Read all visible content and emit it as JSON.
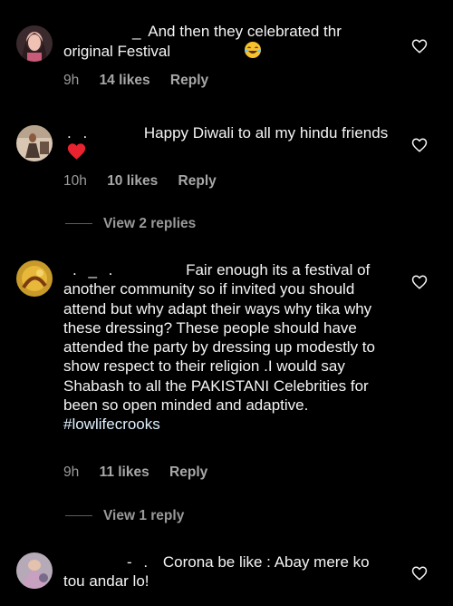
{
  "comments": [
    {
      "user": "_",
      "text": "And then they celebrated thr original Festival",
      "emoji": "laughing-tears-emoji",
      "time": "9h",
      "likes": "14 likes",
      "reply_label": "Reply"
    },
    {
      "user": ". .",
      "text": "Happy Diwali to all my hindu friends",
      "emoji": "red-heart-emoji",
      "time": "10h",
      "likes": "10 likes",
      "reply_label": "Reply",
      "view_replies": "View 2 replies"
    },
    {
      "user": ". _ .",
      "text": "Fair enough its a festival of another community so if invited you should attend but why adapt their ways why tika why these dressing? These people should have attended the party by dressing up modestly to show respect to their religion .I would say  Shabash to all the PAKISTANI Celebrities for been so open minded and adaptive.",
      "hashtag": "#lowlifecrooks",
      "time": "9h",
      "likes": "11 likes",
      "reply_label": "Reply",
      "view_replies": "View 1 reply"
    },
    {
      "user": "- .",
      "text": "Corona be like : Abay mere ko tou andar lo!"
    }
  ],
  "colors": {
    "background": "#000000",
    "text": "#f5f5f5",
    "meta": "#9a9a9a",
    "hashtag": "#e0f1ff"
  },
  "icons": {
    "like": "heart-outline-icon"
  }
}
